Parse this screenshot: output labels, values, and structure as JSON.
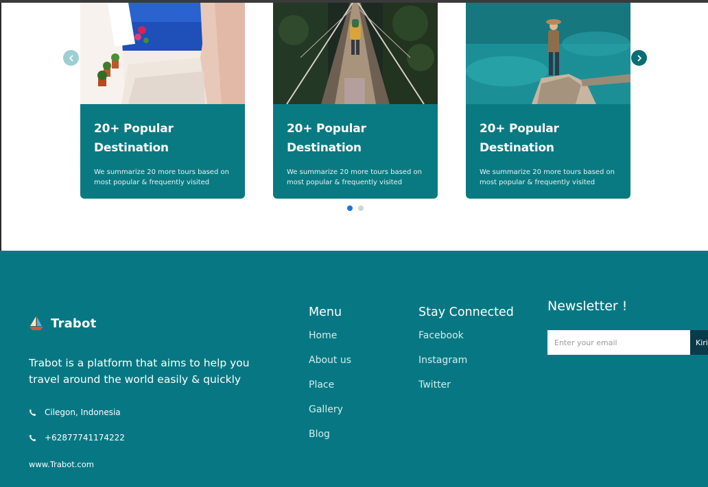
{
  "carousel": {
    "prev_icon": "chevron-left-icon",
    "next_icon": "chevron-right-icon",
    "cards": [
      {
        "title": "20+ Popular Destination",
        "description": "We summarize 20 more tours based on most popular & frequently visited",
        "photo": "greek-island-alley"
      },
      {
        "title": "20+ Popular Destination",
        "description": "We summarize 20 more tours based on most popular & frequently visited",
        "photo": "suspension-bridge-hiker"
      },
      {
        "title": "20+ Popular Destination",
        "description": "We summarize 20 more tours based on most popular & frequently visited",
        "photo": "hiker-on-rock-turquoise-water"
      }
    ],
    "pagination": {
      "total": 2,
      "active": 1
    }
  },
  "footer": {
    "brand": {
      "name": "Trabot",
      "logo_icon": "sailboat-icon"
    },
    "tagline": "Trabot is a platform that aims to help you travel around the world easily & quickly",
    "contacts": [
      {
        "icon": "phone-icon",
        "text": "Cilegon, Indonesia"
      },
      {
        "icon": "phone-icon",
        "text": "+62877741174222"
      }
    ],
    "website": "www.Trabot.com",
    "menu": {
      "title": "Menu",
      "items": [
        "Home",
        "About us",
        "Place",
        "Gallery",
        "Blog"
      ]
    },
    "social": {
      "title": "Stay Connected",
      "items": [
        "Facebook",
        "Instagram",
        "Twitter"
      ]
    },
    "newsletter": {
      "title": "Newsletter !",
      "placeholder": "Enter your email",
      "button": "Kirim"
    }
  },
  "colors": {
    "primary": "#077883",
    "card": "#0a7a82",
    "dark_button": "#0b3a48",
    "active_dot": "#1a73e8"
  }
}
